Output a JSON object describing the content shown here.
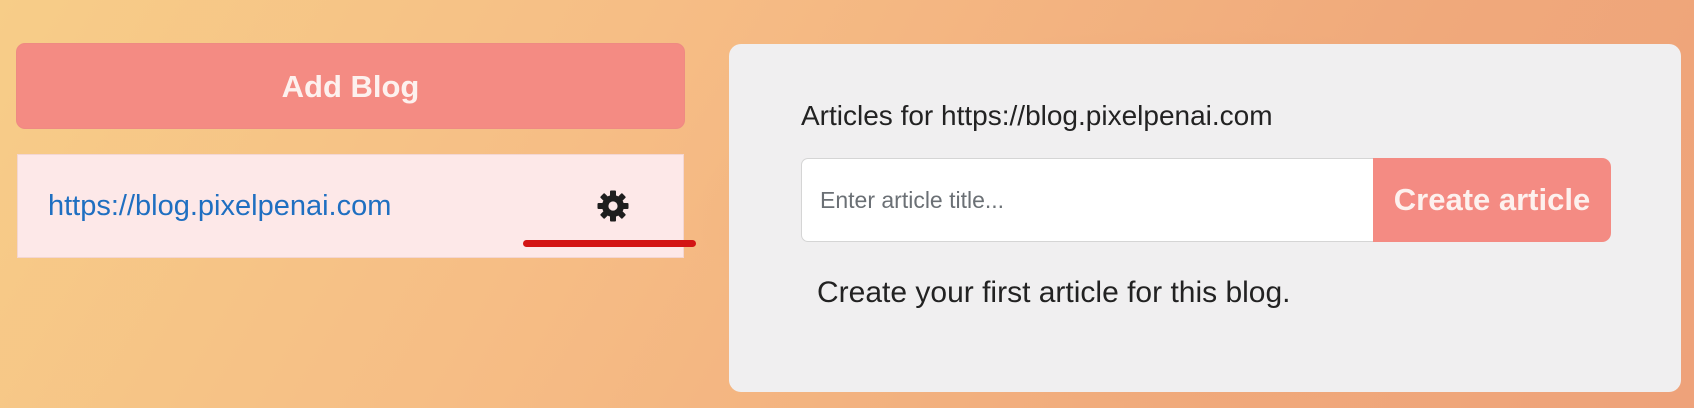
{
  "sidebar": {
    "add_blog_label": "Add Blog",
    "blogs": [
      {
        "url": "https://blog.pixelpenai.com",
        "settings_icon": "gear-icon"
      }
    ]
  },
  "main": {
    "heading": "Articles for https://blog.pixelpenai.com",
    "title_input": {
      "value": "",
      "placeholder": "Enter article title..."
    },
    "create_label": "Create article",
    "empty_message": "Create your first article for this blog."
  },
  "colors": {
    "accent": "#f48b83",
    "link": "#1f6fc1",
    "highlight_mark": "#d31414",
    "panel_bg": "#f0eff0",
    "blog_item_bg": "#fde8e8"
  }
}
